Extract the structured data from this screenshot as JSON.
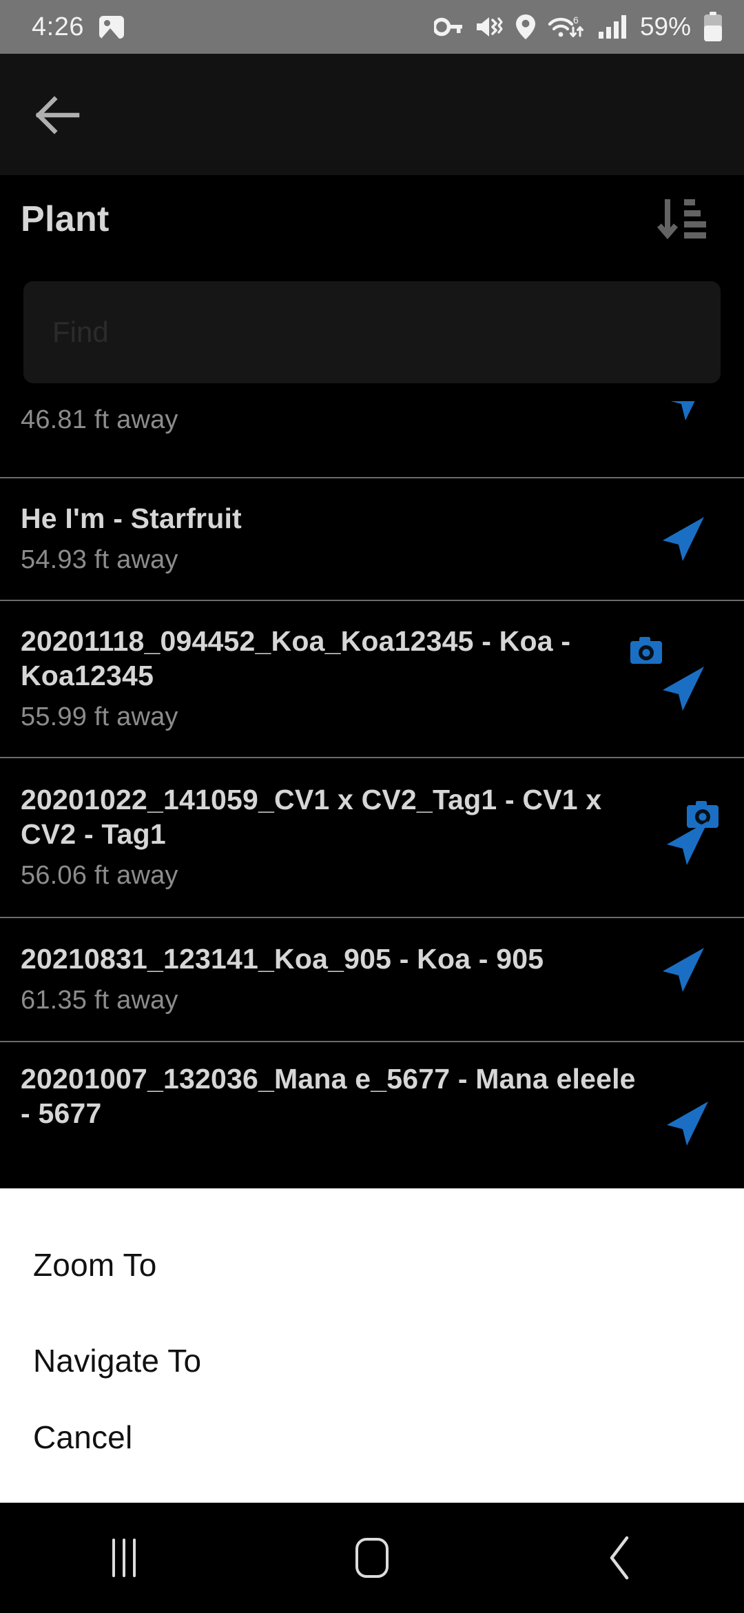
{
  "status_bar": {
    "time": "4:26",
    "battery_percent": "59%",
    "icons": [
      "photo-icon",
      "key-icon",
      "mute-vibrate-icon",
      "location-pin-icon",
      "wifi-6-icon",
      "cellular-signal-icon",
      "battery-icon"
    ],
    "background_color": "#757575",
    "wifi_label": "6"
  },
  "toolbar": {
    "back_icon": "arrow-left-icon"
  },
  "header": {
    "title": "Plant",
    "sort_icon": "sort-descending-icon"
  },
  "search": {
    "placeholder": "Find",
    "value": ""
  },
  "list": {
    "items": [
      {
        "title": "",
        "distance": "46.81 ft away",
        "has_camera": false,
        "has_nav": true,
        "partial": true
      },
      {
        "title": "He I'm - Starfruit",
        "distance": "54.93 ft away",
        "has_camera": false,
        "has_nav": true,
        "partial": false
      },
      {
        "title": "20201118_094452_Koa_Koa12345 - Koa - Koa12345",
        "distance": "55.99 ft away",
        "has_camera": true,
        "has_nav": true,
        "partial": false
      },
      {
        "title": "20201022_141059_CV1 x CV2_Tag1 - CV1 x CV2 - Tag1",
        "distance": "56.06 ft away",
        "has_camera": true,
        "has_nav": true,
        "partial": false
      },
      {
        "title": "20210831_123141_Koa_905 - Koa - 905",
        "distance": "61.35 ft away",
        "has_camera": false,
        "has_nav": true,
        "partial": false
      },
      {
        "title": "20201007_132036_Mana e_5677 - Mana eleele - 5677",
        "distance": "",
        "has_camera": false,
        "has_nav": true,
        "partial": true
      }
    ]
  },
  "dialog": {
    "options": [
      {
        "label": "Zoom To"
      },
      {
        "label": "Navigate To"
      },
      {
        "label": "Cancel"
      }
    ],
    "background_color": "#ffffff"
  },
  "nav_bar": {
    "recent_icon": "recent-apps-icon",
    "home_icon": "home-icon",
    "back_icon": "back-chevron-icon"
  },
  "colors": {
    "accent_blue": "#1a6fc4",
    "list_title": "#d6d6d6",
    "list_sub": "#8c8c8c",
    "divider": "#6c6c6c",
    "app_background": "#000000",
    "toolbar_background": "#121212",
    "search_background": "#161616"
  }
}
